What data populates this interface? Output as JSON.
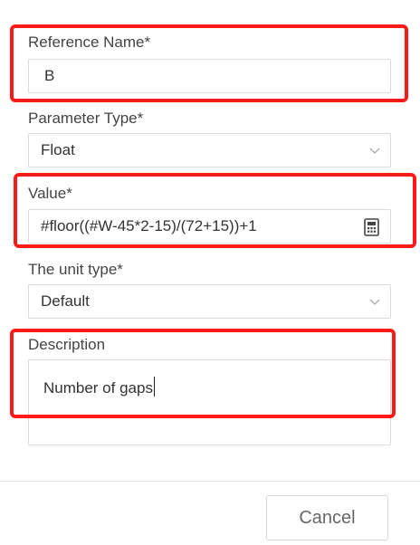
{
  "form": {
    "reference_name": {
      "label": "Reference Name*",
      "value": "B"
    },
    "parameter_type": {
      "label": "Parameter Type*",
      "value": "Float"
    },
    "value": {
      "label": "Value*",
      "value": "#floor((#W-45*2-15)/(72+15))+1"
    },
    "unit_type": {
      "label": "The unit type*",
      "value": "Default"
    },
    "description": {
      "label": "Description",
      "value": "Number of gaps"
    }
  },
  "footer": {
    "cancel_label": "Cancel"
  },
  "icons": {
    "parameter_type_dropdown": "chevron-down-icon",
    "unit_type_dropdown": "chevron-down-icon",
    "value_field_action": "calculator-icon"
  },
  "colors": {
    "highlight": "#ff1a1a",
    "border": "#dcdcdc",
    "text": "#333333"
  }
}
